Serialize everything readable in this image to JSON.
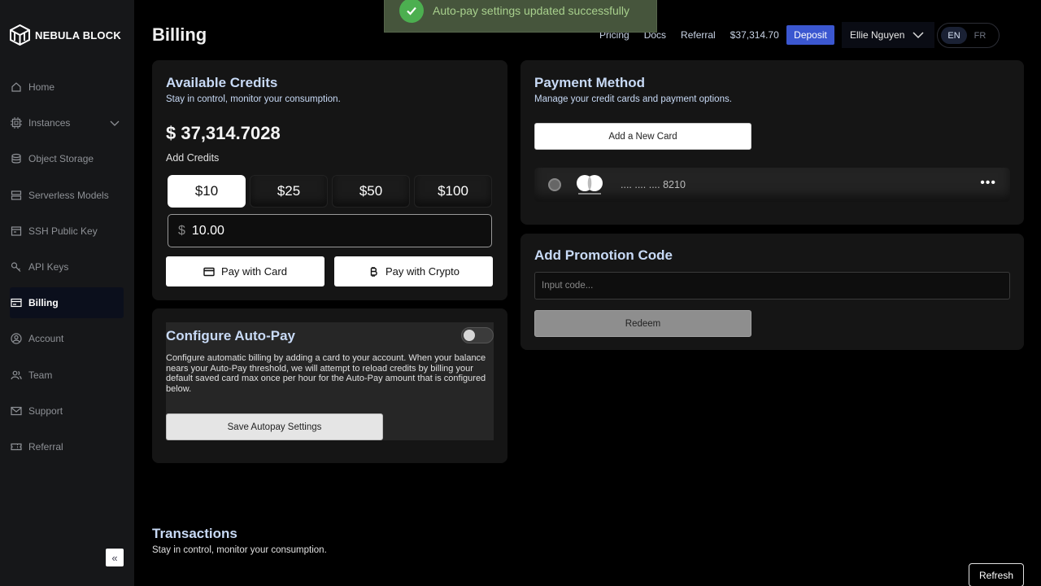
{
  "brand": {
    "name": "NEBULA BLOCK"
  },
  "sidebar": {
    "items": [
      {
        "label": "Home",
        "icon": "home-icon"
      },
      {
        "label": "Instances",
        "icon": "chip-icon"
      },
      {
        "label": "Object Storage",
        "icon": "database-icon"
      },
      {
        "label": "Serverless Models",
        "icon": "server-icon"
      },
      {
        "label": "SSH Public Key",
        "icon": "terminal-icon"
      },
      {
        "label": "API Keys",
        "icon": "key-icon"
      },
      {
        "label": "Billing",
        "icon": "credit-card-icon",
        "active": true
      },
      {
        "label": "Account",
        "icon": "user-circle-icon"
      },
      {
        "label": "Team",
        "icon": "team-icon"
      },
      {
        "label": "Support",
        "icon": "mail-icon"
      },
      {
        "label": "Referral",
        "icon": "ticket-icon"
      }
    ],
    "collapse_icon": "«"
  },
  "header": {
    "title": "Billing",
    "links": [
      "Pricing",
      "Docs",
      "Referral"
    ],
    "balance": "$37,314.70",
    "deposit_label": "Deposit",
    "user_name": "Ellie Nguyen",
    "languages": [
      "EN",
      "FR"
    ],
    "selected_language": "EN"
  },
  "toast": {
    "message": "Auto-pay settings updated successfully",
    "color": "#4caf50"
  },
  "credits": {
    "title": "Available Credits",
    "subtitle": "Stay in control, monitor your consumption.",
    "balance": "$ 37,314.7028",
    "add_label": "Add Credits",
    "amount_options": [
      "$10",
      "$25",
      "$50",
      "$100"
    ],
    "selected_amount": "$10",
    "currency_symbol": "$",
    "amount_value": "10.00",
    "pay_card_label": "Pay with Card",
    "pay_crypto_label": "Pay with Crypto"
  },
  "autopay": {
    "title": "Configure Auto-Pay",
    "enabled": false,
    "description": "Configure automatic billing by adding a card to your account. When your balance nears your Auto-Pay threshold, we will attempt to reload credits by billing your default saved card max once per hour for the Auto-Pay amount that is configured below.",
    "save_label": "Save Autopay Settings"
  },
  "payment": {
    "title": "Payment Method",
    "subtitle": "Manage your credit cards and payment options.",
    "add_card_label": "Add a New Card",
    "card": {
      "brand": "mastercard",
      "masked_number": ".... .... .... 8210",
      "more": "•••"
    }
  },
  "promo": {
    "title": "Add Promotion Code",
    "placeholder": "Input code...",
    "redeem_label": "Redeem"
  },
  "transactions": {
    "title": "Transactions",
    "subtitle": "Stay in control, monitor your consumption.",
    "refresh_label": "Refresh"
  },
  "colors": {
    "accent": "#3b57d0",
    "heading": "#c8daf6",
    "toast_bg": "#46553c",
    "toast_text": "#a8d08d"
  }
}
